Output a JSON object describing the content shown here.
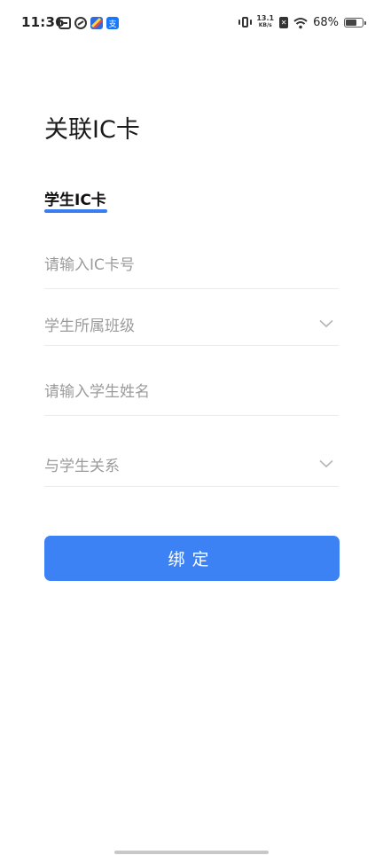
{
  "status_bar": {
    "time": "11:36",
    "net_speed_value": "13.1",
    "net_speed_unit": "KB/s",
    "battery_percent": "68%",
    "battery_level": 0.68,
    "notif_colors": [
      "#333333",
      "#333333",
      "#e74c3c",
      "#2f80ed"
    ]
  },
  "page": {
    "title": "关联IC卡"
  },
  "tabs": [
    {
      "label": "学生IC卡",
      "active": true
    }
  ],
  "form": {
    "ic_card": {
      "placeholder": "请输入IC卡号",
      "value": ""
    },
    "class_select": {
      "placeholder": "学生所属班级"
    },
    "student_name": {
      "placeholder": "请输入学生姓名",
      "value": ""
    },
    "relation_select": {
      "placeholder": "与学生关系"
    }
  },
  "actions": {
    "bind_label": "绑定"
  },
  "colors": {
    "accent": "#3d82f5",
    "tab_indicator": "#3b7cf0",
    "placeholder": "#9b9b9b",
    "divider": "#ececec"
  }
}
